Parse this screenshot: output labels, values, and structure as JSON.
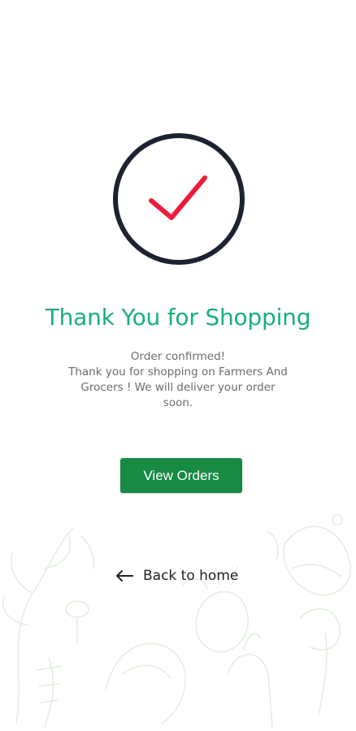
{
  "colors": {
    "accent_title": "#17b07a",
    "button_bg": "#178a43",
    "check_mark": "#ec1c3b",
    "circle_stroke": "#1c2230",
    "text_muted": "#6b6b6b"
  },
  "confirmation": {
    "icon": "check-circle-icon",
    "title": "Thank You for Shopping",
    "message_lines": [
      "Order confirmed!",
      "Thank you for shopping on Farmers And",
      "Grocers ! We will deliver your order",
      "soon."
    ]
  },
  "actions": {
    "view_orders_label": "View Orders",
    "back_home_label": "Back to home",
    "back_icon": "arrow-left-icon"
  }
}
